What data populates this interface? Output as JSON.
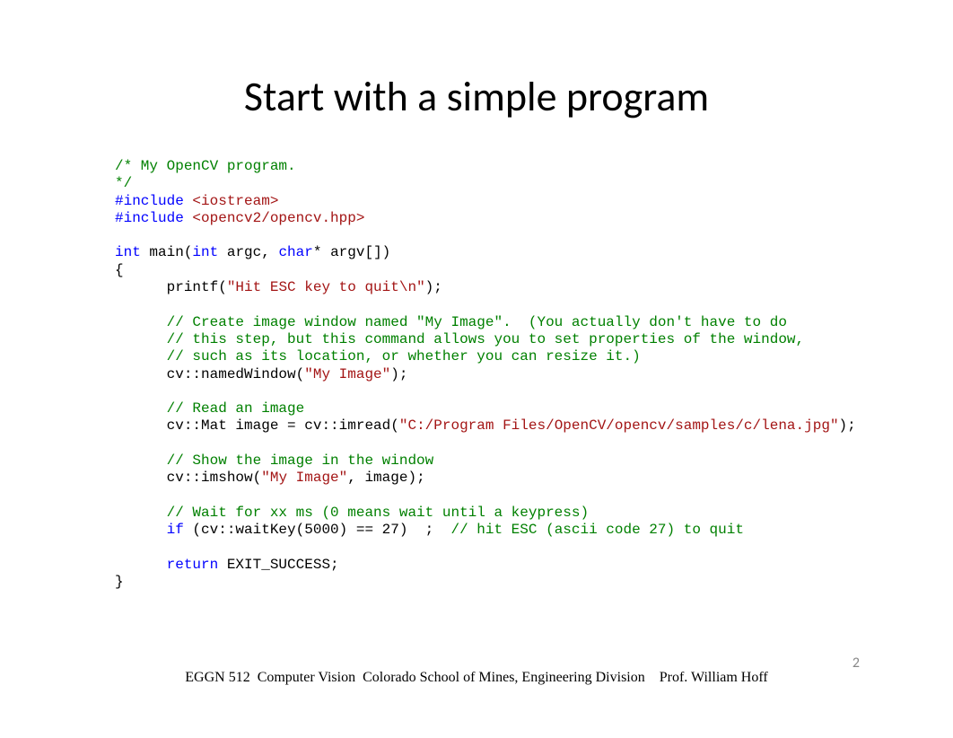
{
  "title": "Start with a simple program",
  "code": {
    "l1": "/* My OpenCV program.",
    "l2": "*/",
    "inc": "#include",
    "hdr1": " <iostream>",
    "hdr2": " <opencv2/opencv.hpp>",
    "kw_int": "int",
    "main_sig_a": " main(",
    "main_sig_b": " argc, ",
    "kw_char": "char",
    "main_sig_c": "* argv[])",
    "brace_open": "{",
    "printf_a": "      printf(",
    "printf_str": "\"Hit ESC key to quit\\n\"",
    "printf_b": ");",
    "cm1a": "      // Create image window named \"My Image\".  (You actually don't have to do",
    "cm1b": "      // this step, but this command allows you to set properties of the window,",
    "cm1c": "      // such as its location, or whether you can resize it.)",
    "nw_a": "      cv::namedWindow(",
    "nw_str": "\"My Image\"",
    "nw_b": ");",
    "cm2": "      // Read an image",
    "imr_a": "      cv::Mat image = cv::imread(",
    "imr_str": "\"C:/Program Files/OpenCV/opencv/samples/c/lena.jpg\"",
    "imr_b": ");",
    "cm3": "      // Show the image in the window",
    "ims_a": "      cv::imshow(",
    "ims_str": "\"My Image\"",
    "ims_b": ", image);",
    "cm4": "      // Wait for xx ms (0 means wait until a keypress)",
    "indent6": "      ",
    "kw_if": "if",
    "if_a": " (cv::waitKey(5000) == 27)  ;  ",
    "cm5": "// hit ESC (ascii code 27) to quit",
    "kw_return": "return",
    "ret_a": " EXIT_SUCCESS;",
    "brace_close": "}"
  },
  "footer": {
    "course": "EGGN 512",
    "subject": "Computer Vision",
    "school": "Colorado School of Mines, Engineering Division",
    "prof": "Prof. William Hoff"
  },
  "page_number": "2"
}
